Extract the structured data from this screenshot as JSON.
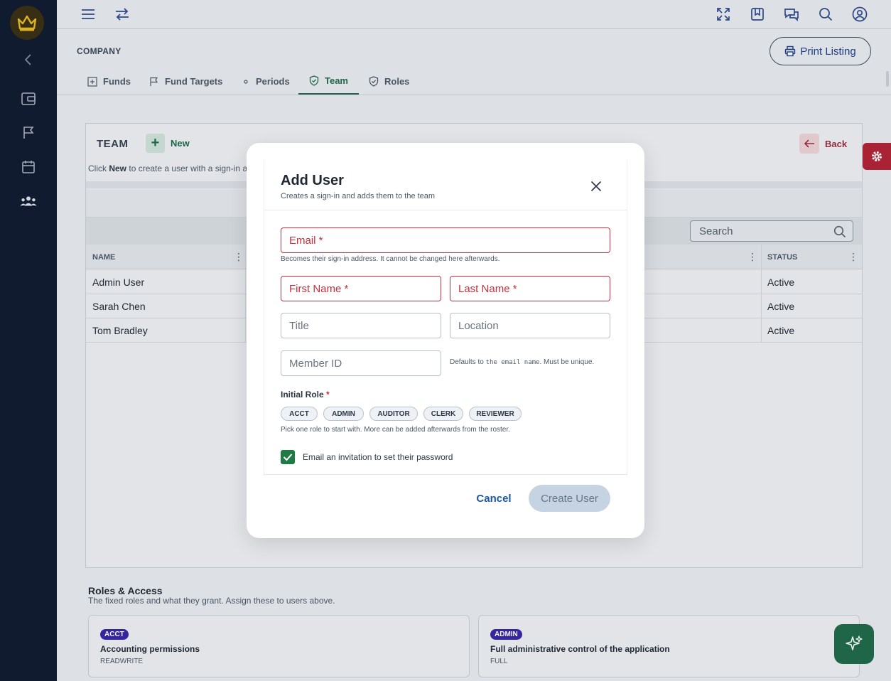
{
  "sidebar": {
    "logo_icon": "crown-icon",
    "items": [
      {
        "icon": "chevron-left-icon"
      },
      {
        "icon": "wallet-icon"
      },
      {
        "icon": "flag-icon"
      },
      {
        "icon": "calendar-icon"
      },
      {
        "icon": "team-icon"
      }
    ],
    "accent": "#e8b923"
  },
  "topbar": {
    "icons": [
      "menu-icon",
      "swap-icon",
      "fullscreen-icon",
      "bookmark-icon",
      "chat-icon",
      "search-icon",
      "account-icon"
    ]
  },
  "header": {
    "section": "COMPANY",
    "print_label": "Print Listing"
  },
  "tabs": [
    {
      "label": "Funds",
      "icon": "plus-square-icon",
      "active": false
    },
    {
      "label": "Fund Targets",
      "icon": "flag-icon",
      "active": false
    },
    {
      "label": "Periods",
      "icon": "dot-icon",
      "active": false
    },
    {
      "label": "Team",
      "icon": "shield-check-icon",
      "active": true
    },
    {
      "label": "Roles",
      "icon": "shield-check-icon",
      "active": false
    }
  ],
  "team": {
    "title": "TEAM",
    "new_label": "New",
    "back_label": "Back",
    "hint_prefix": "Click ",
    "hint_bold": "New",
    "hint_suffix": " to create a user with a sign-in ar",
    "search_placeholder": "Search",
    "columns": {
      "name": "NAME",
      "status": "STATUS"
    },
    "rows": [
      {
        "name": "Admin User",
        "status": "Active"
      },
      {
        "name": "Sarah Chen",
        "status": "Active"
      },
      {
        "name": "Tom Bradley",
        "status": "Active"
      }
    ]
  },
  "roles_section": {
    "title": "Roles & Access",
    "subtitle": "The fixed roles and what they grant. Assign these to users above.",
    "cards": [
      {
        "badge": "ACCT",
        "desc": "Accounting permissions",
        "level": "READWRITE"
      },
      {
        "badge": "ADMIN",
        "desc": "Full administrative control of the application",
        "level": "FULL"
      }
    ]
  },
  "modal": {
    "title": "Add User",
    "subtitle": "Creates a sign-in and adds them to the team",
    "email_placeholder": "Email *",
    "email_helper": "Becomes their sign-in address. It cannot be changed here afterwards.",
    "first_name_placeholder": "First Name *",
    "last_name_placeholder": "Last Name *",
    "title_placeholder": "Title",
    "location_placeholder": "Location",
    "member_id_placeholder": "Member ID",
    "member_id_helper_prefix": "Defaults to ",
    "member_id_helper_code": "the email name",
    "member_id_helper_suffix": ". Must be unique.",
    "role_label": "Initial Role",
    "role_star": "*",
    "roles": [
      "ACCT",
      "ADMIN",
      "AUDITOR",
      "CLERK",
      "REVIEWER"
    ],
    "role_helper": "Pick one role to start with. More can be added afterwards from the roster.",
    "invite_label": "Email an invitation to set their password",
    "invite_checked": true,
    "cancel_label": "Cancel",
    "create_label": "Create User"
  },
  "colors": {
    "sidebar_bg": "#0f1a2e",
    "primary_green": "#1f6a4a",
    "required_red": "#c62f3d",
    "link_blue": "#1c57a8",
    "badge_purple": "#3726a6"
  }
}
